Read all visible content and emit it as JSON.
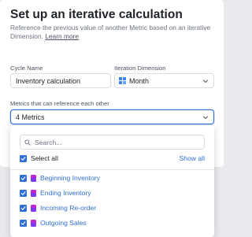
{
  "modal": {
    "title": "Set up an iterative calculation",
    "subtitle": "Reference the previous value of another Metric based on an iterative Dimension.",
    "learn_more": "Learn more"
  },
  "form": {
    "cycle_name_label": "Cycle Name",
    "cycle_name_value": "Inventory calculation",
    "iteration_dimension_label": "Iteration Dimension",
    "iteration_dimension_value": "Month",
    "iteration_dimension_icon": "dimension-grid-icon",
    "metrics_label": "Metrics that can reference each other",
    "metrics_value": "4 Metrics"
  },
  "dropdown": {
    "search_placeholder": "Search...",
    "select_all_label": "Select all",
    "show_all_label": "Show all",
    "items": [
      {
        "label": "Beginning Inventory",
        "checked": true
      },
      {
        "label": "Ending Inventory",
        "checked": true
      },
      {
        "label": "Incoming Re-order",
        "checked": true
      },
      {
        "label": "Outgoing Sales",
        "checked": true
      }
    ]
  },
  "colors": {
    "accent": "#2f6fd6",
    "metric_icon_top": "#c026d3",
    "metric_icon_bottom": "#7c3aed",
    "dimension_icon": "#3b82f6"
  }
}
